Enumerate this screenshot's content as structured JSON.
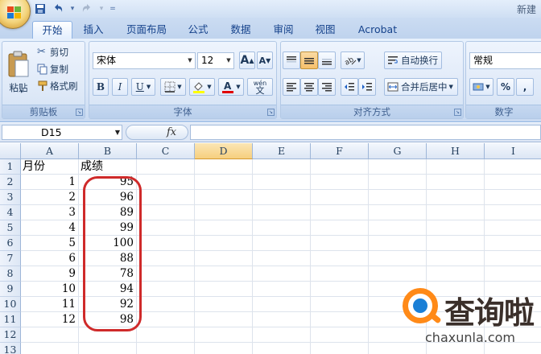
{
  "app": {
    "title": "新建"
  },
  "quick_access": {
    "save_icon": "save-icon",
    "undo_icon": "undo-icon",
    "redo_icon": "redo-icon"
  },
  "tabs": [
    {
      "label": "开始",
      "active": true
    },
    {
      "label": "插入"
    },
    {
      "label": "页面布局"
    },
    {
      "label": "公式"
    },
    {
      "label": "数据"
    },
    {
      "label": "审阅"
    },
    {
      "label": "视图"
    },
    {
      "label": "Acrobat"
    }
  ],
  "clipboard": {
    "paste_label": "粘贴",
    "cut_label": "剪切",
    "copy_label": "复制",
    "format_painter_label": "格式刷",
    "group_label": "剪贴板"
  },
  "font": {
    "name": "宋体",
    "size": "12",
    "bold": "B",
    "italic": "I",
    "underline": "U",
    "group_label": "字体",
    "phonetic_label": "wén",
    "phonetic_char": "文",
    "grow_label": "A",
    "shrink_label": "A"
  },
  "alignment": {
    "wrap_label": "自动换行",
    "merge_label": "合并后居中",
    "group_label": "对齐方式"
  },
  "number": {
    "format": "常规",
    "percent": "%",
    "comma": ",",
    "group_label": "数字"
  },
  "formula_bar": {
    "name_box": "D15",
    "fx_label": "fx",
    "formula": ""
  },
  "columns": [
    "A",
    "B",
    "C",
    "D",
    "E",
    "F",
    "G",
    "H",
    "I"
  ],
  "selected_column": "D",
  "rows": [
    {
      "n": "1",
      "a": "月份",
      "b": "成绩"
    },
    {
      "n": "2",
      "a": "1",
      "b": "95"
    },
    {
      "n": "3",
      "a": "2",
      "b": "96"
    },
    {
      "n": "4",
      "a": "3",
      "b": "89"
    },
    {
      "n": "5",
      "a": "4",
      "b": "99"
    },
    {
      "n": "6",
      "a": "5",
      "b": "100"
    },
    {
      "n": "7",
      "a": "6",
      "b": "88"
    },
    {
      "n": "8",
      "a": "9",
      "b": "78"
    },
    {
      "n": "9",
      "a": "10",
      "b": "94"
    },
    {
      "n": "10",
      "a": "11",
      "b": "92"
    },
    {
      "n": "11",
      "a": "12",
      "b": "98"
    },
    {
      "n": "12",
      "a": "",
      "b": ""
    },
    {
      "n": "13",
      "a": "",
      "b": ""
    }
  ],
  "annotation_color": "#cf2a2a",
  "watermark": {
    "cn": "查询啦",
    "en": "chaxunla.com"
  }
}
